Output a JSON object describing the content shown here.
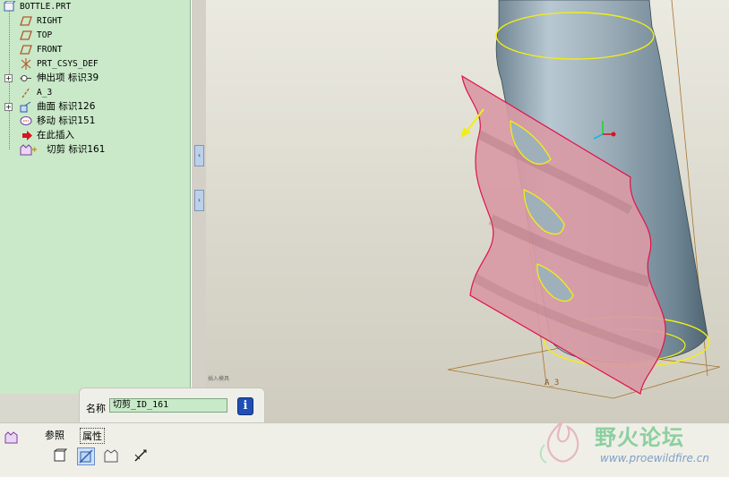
{
  "model_tree": {
    "root": "BOTTLE.PRT",
    "items": [
      {
        "label": "RIGHT",
        "icon": "datum-plane-icon"
      },
      {
        "label": "TOP",
        "icon": "datum-plane-icon"
      },
      {
        "label": "FRONT",
        "icon": "datum-plane-icon"
      },
      {
        "label": "PRT_CSYS_DEF",
        "icon": "coordinate-system-icon"
      },
      {
        "label": "伸出项 标识39",
        "icon": "extrude-icon"
      },
      {
        "label": "A_3",
        "icon": "datum-axis-icon"
      },
      {
        "label": "曲面 标识126",
        "icon": "surface-icon"
      },
      {
        "label": "移动 标识151",
        "icon": "move-icon"
      },
      {
        "label": "在此插入",
        "icon": "insert-here-arrow-icon"
      },
      {
        "label": "切剪 标识161",
        "icon": "cut-icon"
      }
    ]
  },
  "splitter": {
    "up": "‹",
    "down": "›"
  },
  "viewport": {
    "axis_label": "A_3",
    "tiny_note": "插入模具"
  },
  "name_popup": {
    "label": "名称",
    "value": "切剪_ID_161",
    "info": "i"
  },
  "dashboard": {
    "tab_references": "参照",
    "tab_properties": "属性"
  },
  "watermark": {
    "brand": "野火论坛",
    "url": "www.proewildfire.cn"
  },
  "colors": {
    "tree_bg": "#c9e9c9",
    "highlight_yellow": "#f2ee14",
    "surface_pink": "#d89aa5",
    "edge_red": "#e0124b",
    "datum_brown": "#a8742f"
  }
}
